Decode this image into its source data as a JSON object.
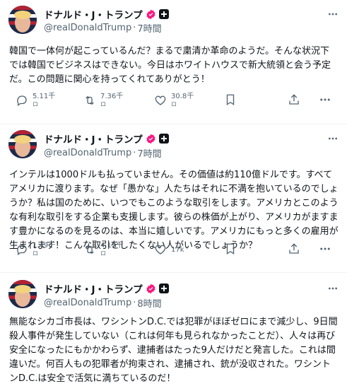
{
  "author": {
    "name": "ドナルド・J・トランプ",
    "handle": "@realDonaldTrump"
  },
  "posts": [
    {
      "time": "7時間",
      "text": "韓国で一体何が起こっているんだ？まるで粛清か革命のようだ。そんな状況下では韓国でビジネスはできない。今日はホワイトハウスで新大統領と会う予定だ。この問題に関心を持ってくれてありがとう！",
      "replies": "5.11千",
      "reposts": "7.36千",
      "likes": "30.8千",
      "replies_sub": "ロ",
      "reposts_sub": "ロ",
      "likes_sub": "ロ"
    },
    {
      "time": "7時間",
      "text": "インテルは1000ドルも払っていません。その価値は約110億ドルです。すべてアメリカに渡ります。なぜ「愚かな」人たちはそれに不満を抱いているのでしょうか？私は国のために、いつでもこのような取引をします。アメリカとこのような有利な取引をする企業も支援します。彼らの株価が上がり、アメリカがますます豊かになるのを見るのは、本当に嬉しいです。アメリカにもっと多くの雇用が生まれます！こんな取引をしたくない人がいるでしょうか？",
      "replies": "1.49千",
      "reposts": "4.12千",
      "likes": "17k",
      "replies_sub": "ロ",
      "reposts_sub": "ロ"
    },
    {
      "time": "8時間",
      "text": "無能なシカゴ市長は、ワシントンD.C.では犯罪がほぼゼロにまで減少し、9日間殺人事件が発生していない（これは何年も見られなかったことだ）、人々は再び安全になったにもかかわらず、逮捕者はたった9人だけだと発言した。これは間違いだ。何百人もの犯罪者が拘束され、逮捕され、銃が没収された。ワシントンD.C.は安全で活気に満ちているのだ！"
    }
  ],
  "colors": {
    "verified": "#f91880",
    "text": "#0f1419",
    "muted": "#536471"
  }
}
